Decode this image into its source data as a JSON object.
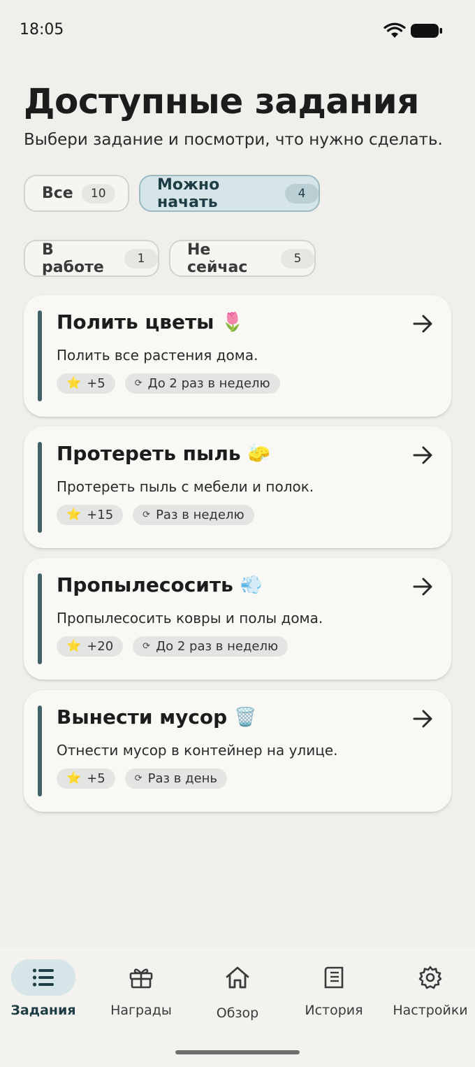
{
  "status_bar": {
    "time": "18:05"
  },
  "header": {
    "title": "Доступные задания",
    "subtitle": "Выбери задание и посмотри, что нужно сделать."
  },
  "filters": [
    {
      "label": "Все",
      "count": "10",
      "active": false
    },
    {
      "label": "Можно начать",
      "count": "4",
      "active": true
    },
    {
      "label": "В работе",
      "count": "1",
      "active": false
    },
    {
      "label": "Не сейчас",
      "count": "5",
      "active": false
    }
  ],
  "tasks": [
    {
      "title": "Полить цветы",
      "emoji": "🌷",
      "description": "Полить все растения дома.",
      "points": "+5",
      "frequency": "До 2 раз в неделю"
    },
    {
      "title": "Протереть пыль",
      "emoji": "🧽",
      "description": "Протереть пыль с мебели и полок.",
      "points": "+15",
      "frequency": "Раз в неделю"
    },
    {
      "title": "Пропылесосить",
      "emoji": "💨",
      "description": "Пропылесосить ковры и полы дома.",
      "points": "+20",
      "frequency": "До 2 раз в неделю"
    },
    {
      "title": "Вынести мусор",
      "emoji": "🗑️",
      "description": "Отнести мусор в контейнер на улице.",
      "points": "+5",
      "frequency": "Раз в день"
    }
  ],
  "icons": {
    "star": "⭐",
    "cycle": "⟳"
  },
  "nav": [
    {
      "label": "Задания",
      "icon": "list-icon",
      "active": true
    },
    {
      "label": "Награды",
      "icon": "gift-icon",
      "active": false
    },
    {
      "label": "Обзор",
      "icon": "home-icon",
      "active": false
    },
    {
      "label": "История",
      "icon": "history-icon",
      "active": false
    },
    {
      "label": "Настройки",
      "icon": "gear-icon",
      "active": false
    }
  ],
  "colors": {
    "accent": "#3f6368",
    "chip_active_bg": "#d5e5e8",
    "background": "#f0efec",
    "card_bg": "#f9f8f4"
  }
}
